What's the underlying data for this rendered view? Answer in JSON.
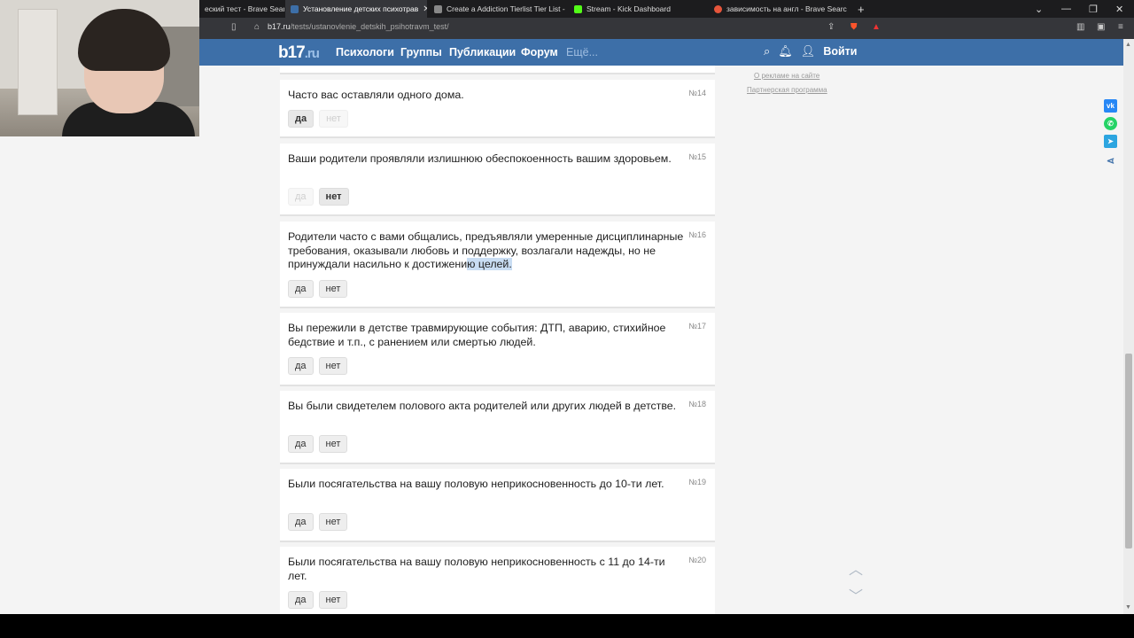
{
  "browser": {
    "tabs": [
      {
        "label": "еский тест - Brave Search",
        "active": false
      },
      {
        "label": "Установление детских психотрав",
        "active": true
      },
      {
        "label": "Create a Addiction Tierlist Tier List - Ti",
        "active": false
      },
      {
        "label": "Stream - Kick Dashboard",
        "active": false
      },
      {
        "label": "зависимость на англ - Brave Search",
        "active": false
      }
    ],
    "new_tab": "+",
    "url_host": "b17.ru",
    "url_path": "/tests/ustanovlenie_detskih_psihotravm_test/"
  },
  "site": {
    "logo": "b17",
    "logo_suffix": ".ru",
    "nav": [
      "Психологи",
      "Группы",
      "Публикации",
      "Форум",
      "Ещё..."
    ],
    "login": "Войти"
  },
  "sidebar": {
    "links": [
      "О рекламе на сайте",
      "Партнерская программа"
    ]
  },
  "questions": [
    {
      "num": "№14",
      "text": "Часто вас оставляли одного дома.",
      "yes": "да",
      "no": "нет",
      "selected": "yes"
    },
    {
      "num": "№15",
      "text": "Ваши родители проявляли излишнюю обеспокоенность вашим здоровьем.",
      "yes": "да",
      "no": "нет",
      "selected": "no"
    },
    {
      "num": "№16",
      "text_before": "Родители часто с вами общались, предъявляли умеренные дисциплинарные требования, оказывали любовь и поддержку, возлагали надежды, но не принуждали насильно к достижени",
      "text_highlight": "ю целей.",
      "yes": "да",
      "no": "нет",
      "selected": "none"
    },
    {
      "num": "№17",
      "text": "Вы пережили в детстве травмирующие события: ДТП, аварию, стихийное бедствие и т.п., с ранением или смертью людей.",
      "yes": "да",
      "no": "нет",
      "selected": "none"
    },
    {
      "num": "№18",
      "text": "Вы были свидетелем полового акта родителей или других людей в детстве.",
      "yes": "да",
      "no": "нет",
      "selected": "none"
    },
    {
      "num": "№19",
      "text": "Были посягательства на вашу половую неприкосновенность до 10-ти лет.",
      "yes": "да",
      "no": "нет",
      "selected": "none"
    },
    {
      "num": "№20",
      "text": "Были посягательства на вашу половую неприкосновенность с 11 до 14-ти лет.",
      "yes": "да",
      "no": "нет",
      "selected": "none"
    }
  ],
  "colors": {
    "nav_bg": "#3d6fa8",
    "highlight": "#c9ddf3"
  }
}
